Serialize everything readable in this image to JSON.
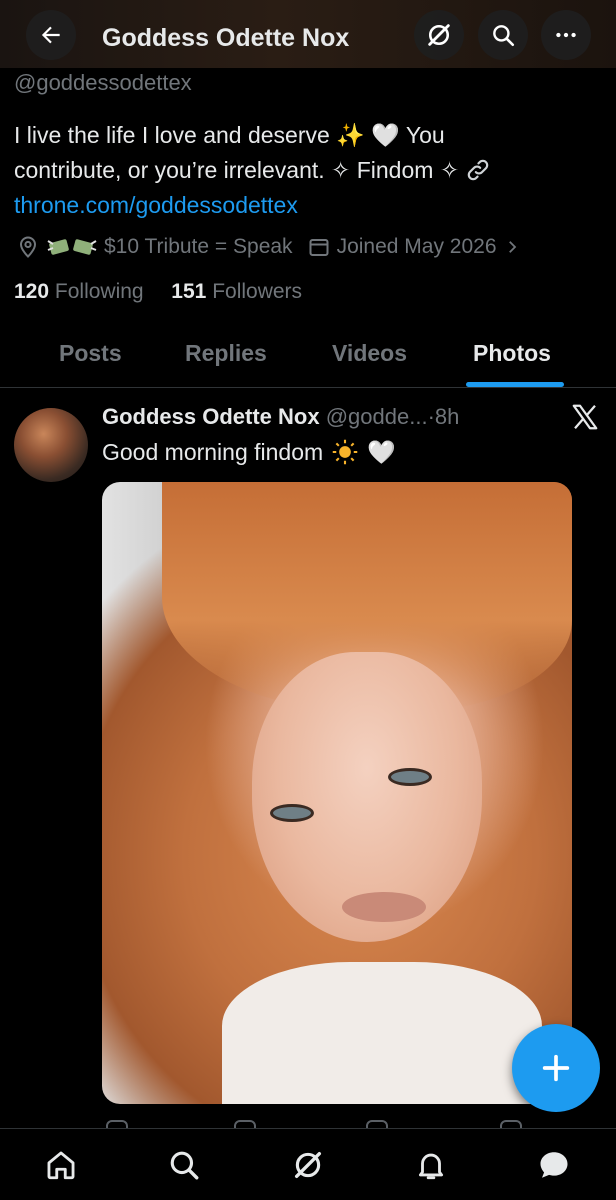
{
  "header": {
    "title": "Goddess Odette Nox",
    "icons": [
      "back-arrow-icon",
      "grok-icon",
      "search-icon",
      "more-icon"
    ]
  },
  "profile": {
    "handle": "@goddessodettex",
    "bio_line1": "I live the life I love and deserve",
    "bio_line1_end": "You",
    "bio_line2": "contribute, or you’re irrelevant.",
    "bio_findom": "Findom",
    "sparkle_glyph": "✧",
    "bio_emoji_sparkles": "✨",
    "bio_emoji_heart": "🤍",
    "link": "throne.com/goddessodettex",
    "tribute": "$10 Tribute = Speak",
    "joined": "Joined May 2026",
    "following_count": "120",
    "following_label": "Following",
    "followers_count": "151",
    "followers_label": "Followers"
  },
  "tabs": [
    {
      "label": "Posts",
      "active": false
    },
    {
      "label": "Replies",
      "active": false
    },
    {
      "label": "Videos",
      "active": false
    },
    {
      "label": "Photos",
      "active": true
    }
  ],
  "post": {
    "author": "Goddess Odette Nox",
    "handle_truncated": "@godde...",
    "separator": "·",
    "time": "8h",
    "text": "Good morning findom",
    "emoji_heart": "🤍"
  },
  "colors": {
    "accent": "#1d9bf0",
    "text_primary": "#e7e9ea",
    "text_secondary": "#71767b",
    "background": "#000000"
  }
}
